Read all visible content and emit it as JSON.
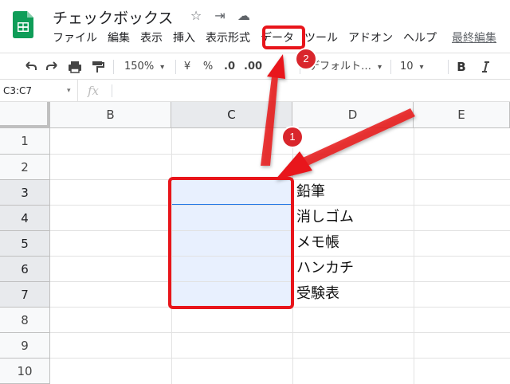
{
  "app": {
    "title": "チェックボックス",
    "title_icons": [
      "☆",
      "⇥",
      "☁"
    ]
  },
  "menu": {
    "items": [
      "ファイル",
      "編集",
      "表示",
      "挿入",
      "表示形式",
      "データ",
      "ツール",
      "アドオン",
      "ヘルプ"
    ],
    "last_edit": "最終編集"
  },
  "toolbar": {
    "zoom": "150%",
    "currency": "¥",
    "percent": "%",
    "dec_decrease": ".0",
    "dec_increase": ".00",
    "font_name": "デフォルト…",
    "font_size": "10",
    "bold": "B"
  },
  "formula_bar": {
    "name_box": "C3:C7",
    "fx": "fx",
    "value": ""
  },
  "grid": {
    "columns": [
      "B",
      "C",
      "D",
      "E"
    ],
    "selected_column": "C",
    "rows": [
      "1",
      "2",
      "3",
      "4",
      "5",
      "6",
      "7",
      "8",
      "9",
      "10"
    ],
    "selected_rows": [
      "3",
      "4",
      "5",
      "6",
      "7"
    ],
    "d_column": [
      "鉛筆",
      "消しゴム",
      "メモ帳",
      "ハンカチ",
      "受験表"
    ]
  },
  "annotations": {
    "badge_1": "1",
    "badge_2": "2",
    "color": "#e8151b"
  }
}
